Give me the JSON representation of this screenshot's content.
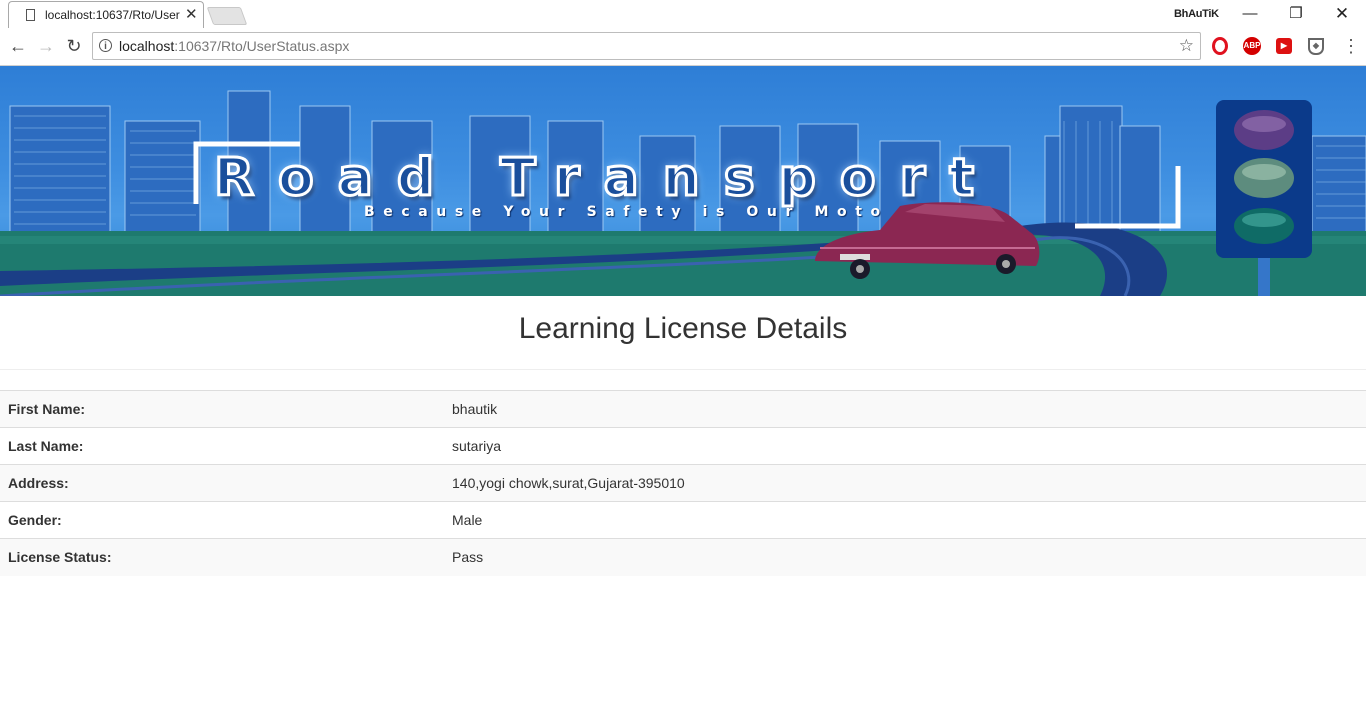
{
  "browser": {
    "tab_title": "localhost:10637/Rto/User",
    "profile_name": "BhAuTiK",
    "url_host": "localhost",
    "url_rest": ":10637/Rto/UserStatus.aspx",
    "extensions": [
      "opera-icon",
      "adblock-plus-icon",
      "red-extension-icon",
      "shield-extension-icon"
    ],
    "abp_label": "ABP"
  },
  "banner": {
    "title": "Road Transport",
    "tagline": "Because Your Safety is Our Moto"
  },
  "page": {
    "heading": "Learning License Details",
    "rows": [
      {
        "label": "First Name:",
        "value": "bhautik"
      },
      {
        "label": "Last Name:",
        "value": "sutariya"
      },
      {
        "label": "Address:",
        "value": "140,yogi chowk,surat,Gujarat-395010"
      },
      {
        "label": "Gender:",
        "value": "Male"
      },
      {
        "label": "License Status:",
        "value": "Pass"
      }
    ]
  }
}
